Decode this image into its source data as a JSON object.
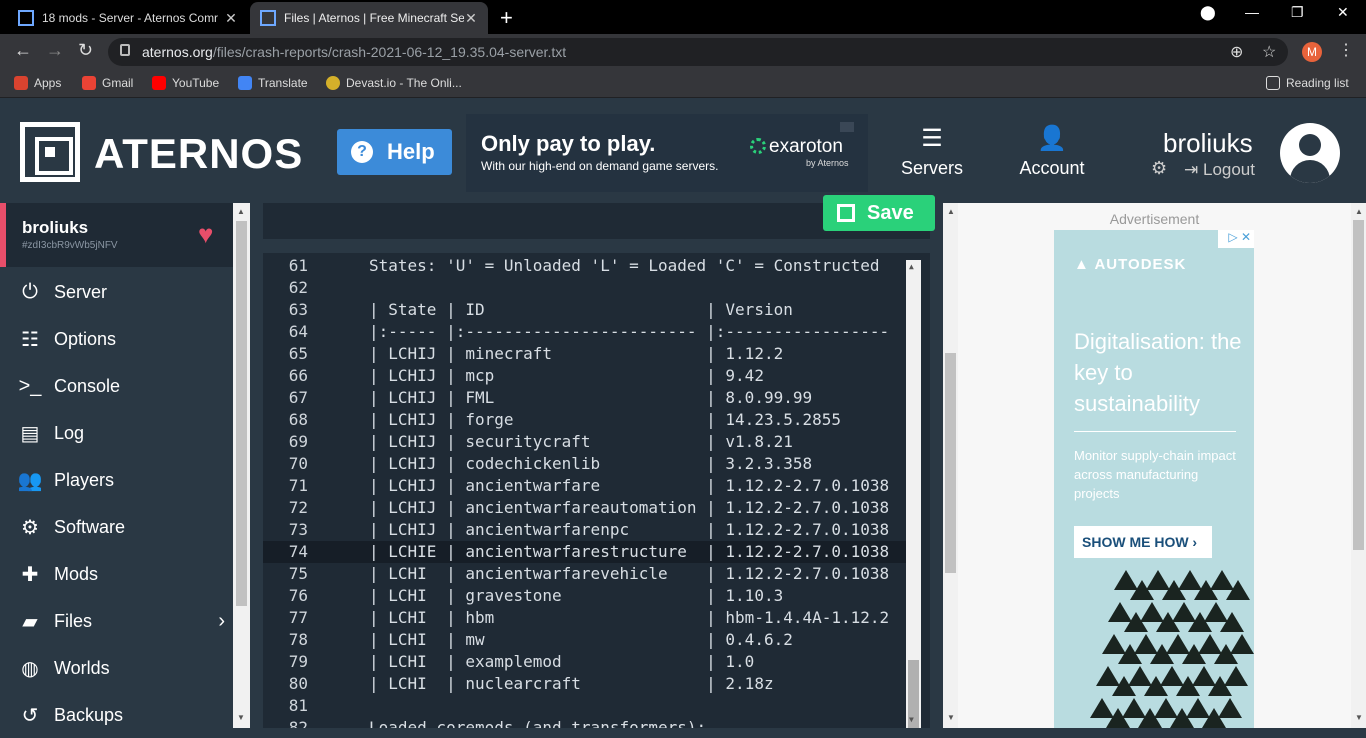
{
  "browser": {
    "tabs": [
      {
        "title": "18 mods - Server - Aternos Comr",
        "active": false
      },
      {
        "title": "Files | Aternos | Free Minecraft Se",
        "active": true
      }
    ],
    "url_domain": "aternos.org",
    "url_path": "/files/crash-reports/crash-2021-06-12_19.35.04-server.txt",
    "profile_initial": "M",
    "bookmarks": [
      "Apps",
      "Gmail",
      "YouTube",
      "Translate",
      "Devast.io - The Onli..."
    ],
    "reading_list": "Reading list"
  },
  "header": {
    "logo_text": "ATERNOS",
    "help_label": "Help",
    "ad": {
      "title": "Only pay to play.",
      "subtitle": "With our high-end on demand game servers.",
      "brand": "exaroton",
      "brand_by": "by Aternos"
    },
    "nav": [
      {
        "label": "Servers",
        "icon": "servers-icon"
      },
      {
        "label": "Account",
        "icon": "account-icon"
      }
    ],
    "username": "broliuks",
    "logout_label": "Logout"
  },
  "sidebar": {
    "server_name": "broliuks",
    "server_id": "#zdI3cbR9vWb5jNFV",
    "items": [
      {
        "label": "Server",
        "icon": "power-icon"
      },
      {
        "label": "Options",
        "icon": "options-icon"
      },
      {
        "label": "Console",
        "icon": "console-icon"
      },
      {
        "label": "Log",
        "icon": "log-icon"
      },
      {
        "label": "Players",
        "icon": "players-icon"
      },
      {
        "label": "Software",
        "icon": "software-icon"
      },
      {
        "label": "Mods",
        "icon": "mods-icon"
      },
      {
        "label": "Files",
        "icon": "folder-icon"
      },
      {
        "label": "Worlds",
        "icon": "globe-icon"
      },
      {
        "label": "Backups",
        "icon": "backups-icon"
      }
    ]
  },
  "editor": {
    "save_label": "Save",
    "highlighted_line": 74,
    "lines": [
      {
        "n": "61",
        "text": "States: 'U' = Unloaded 'L' = Loaded 'C' = Constructed"
      },
      {
        "n": "62",
        "text": ""
      },
      {
        "n": "63",
        "text": "| State | ID                       | Version"
      },
      {
        "n": "64",
        "text": "|:----- |:------------------------ |:-----------------"
      },
      {
        "n": "65",
        "text": "| LCHIJ | minecraft                | 1.12.2"
      },
      {
        "n": "66",
        "text": "| LCHIJ | mcp                      | 9.42"
      },
      {
        "n": "67",
        "text": "| LCHIJ | FML                      | 8.0.99.99"
      },
      {
        "n": "68",
        "text": "| LCHIJ | forge                    | 14.23.5.2855"
      },
      {
        "n": "69",
        "text": "| LCHIJ | securitycraft            | v1.8.21"
      },
      {
        "n": "70",
        "text": "| LCHIJ | codechickenlib           | 3.2.3.358"
      },
      {
        "n": "71",
        "text": "| LCHIJ | ancientwarfare           | 1.12.2-2.7.0.1038"
      },
      {
        "n": "72",
        "text": "| LCHIJ | ancientwarfareautomation | 1.12.2-2.7.0.1038"
      },
      {
        "n": "73",
        "text": "| LCHIJ | ancientwarfarenpc        | 1.12.2-2.7.0.1038"
      },
      {
        "n": "74",
        "text": "| LCHIE | ancientwarfarestructure  | 1.12.2-2.7.0.1038"
      },
      {
        "n": "75",
        "text": "| LCHI  | ancientwarfarevehicle    | 1.12.2-2.7.0.1038"
      },
      {
        "n": "76",
        "text": "| LCHI  | gravestone               | 1.10.3"
      },
      {
        "n": "77",
        "text": "| LCHI  | hbm                      | hbm-1.4.4A-1.12.2"
      },
      {
        "n": "78",
        "text": "| LCHI  | mw                       | 0.4.6.2"
      },
      {
        "n": "79",
        "text": "| LCHI  | examplemod               | 1.0"
      },
      {
        "n": "80",
        "text": "| LCHI  | nuclearcraft             | 2.18z"
      },
      {
        "n": "81",
        "text": ""
      },
      {
        "n": "82",
        "text": "Loaded coremods (and transformers):"
      }
    ]
  },
  "advertisement": {
    "label": "Advertisement",
    "brand": "AUTODESK",
    "headline": "Digitalisation: the key to sustainability",
    "body": "Monitor supply-chain impact across manufacturing projects",
    "cta": "SHOW ME HOW ›"
  }
}
